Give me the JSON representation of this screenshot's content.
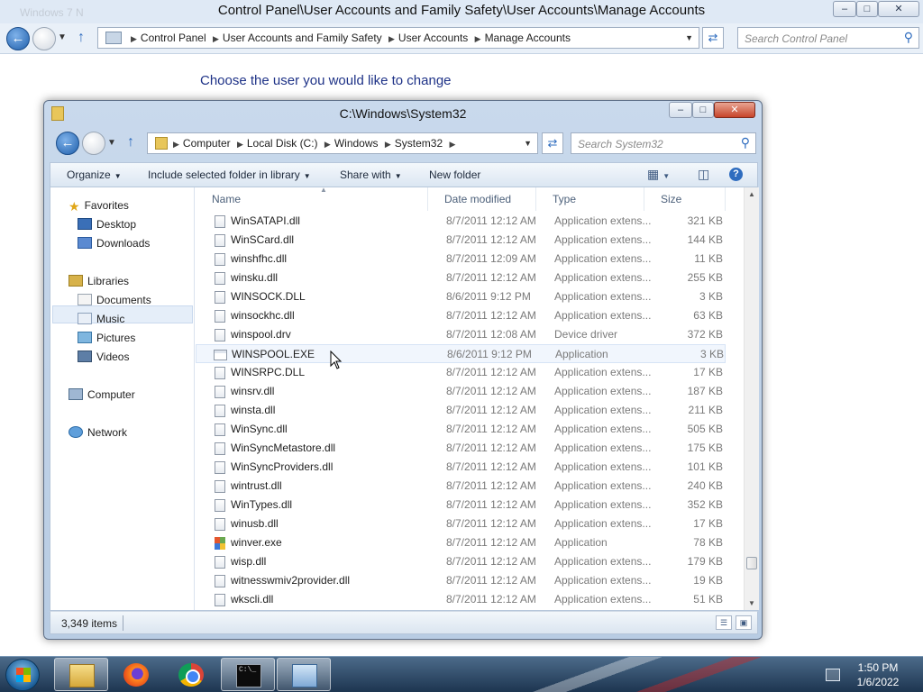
{
  "control_panel": {
    "ghost_title": "Windows 7 N",
    "title": "Control Panel\\User Accounts and Family Safety\\User Accounts\\Manage Accounts",
    "breadcrumbs": [
      "Control Panel",
      "User Accounts and Family Safety",
      "User Accounts",
      "Manage Accounts"
    ],
    "search_placeholder": "Search Control Panel",
    "heading": "Choose the user you would like to change"
  },
  "explorer": {
    "title": "C:\\Windows\\System32",
    "breadcrumbs": [
      "Computer",
      "Local Disk (C:)",
      "Windows",
      "System32"
    ],
    "search_placeholder": "Search System32",
    "toolbar": {
      "organize": "Organize",
      "include": "Include selected folder in library",
      "share": "Share with",
      "new_folder": "New folder"
    },
    "nav": {
      "favorites": "Favorites",
      "desktop": "Desktop",
      "downloads": "Downloads",
      "libraries": "Libraries",
      "documents": "Documents",
      "music": "Music",
      "pictures": "Pictures",
      "videos": "Videos",
      "computer": "Computer",
      "network": "Network"
    },
    "columns": {
      "name": "Name",
      "date": "Date modified",
      "type": "Type",
      "size": "Size"
    },
    "files": [
      {
        "name": "WinSATAPI.dll",
        "date": "8/7/2011 12:12 AM",
        "type": "Application extens...",
        "size": "321 KB",
        "icon": "dll"
      },
      {
        "name": "WinSCard.dll",
        "date": "8/7/2011 12:12 AM",
        "type": "Application extens...",
        "size": "144 KB",
        "icon": "dll"
      },
      {
        "name": "winshfhc.dll",
        "date": "8/7/2011 12:09 AM",
        "type": "Application extens...",
        "size": "11 KB",
        "icon": "dll"
      },
      {
        "name": "winsku.dll",
        "date": "8/7/2011 12:12 AM",
        "type": "Application extens...",
        "size": "255 KB",
        "icon": "dll"
      },
      {
        "name": "WINSOCK.DLL",
        "date": "8/6/2011 9:12 PM",
        "type": "Application extens...",
        "size": "3 KB",
        "icon": "dll"
      },
      {
        "name": "winsockhc.dll",
        "date": "8/7/2011 12:12 AM",
        "type": "Application extens...",
        "size": "63 KB",
        "icon": "dll"
      },
      {
        "name": "winspool.drv",
        "date": "8/7/2011 12:08 AM",
        "type": "Device driver",
        "size": "372 KB",
        "icon": "dll"
      },
      {
        "name": "WINSPOOL.EXE",
        "date": "8/6/2011 9:12 PM",
        "type": "Application",
        "size": "3 KB",
        "icon": "exe"
      },
      {
        "name": "WINSRPC.DLL",
        "date": "8/7/2011 12:12 AM",
        "type": "Application extens...",
        "size": "17 KB",
        "icon": "dll"
      },
      {
        "name": "winsrv.dll",
        "date": "8/7/2011 12:12 AM",
        "type": "Application extens...",
        "size": "187 KB",
        "icon": "dll"
      },
      {
        "name": "winsta.dll",
        "date": "8/7/2011 12:12 AM",
        "type": "Application extens...",
        "size": "211 KB",
        "icon": "dll"
      },
      {
        "name": "WinSync.dll",
        "date": "8/7/2011 12:12 AM",
        "type": "Application extens...",
        "size": "505 KB",
        "icon": "dll"
      },
      {
        "name": "WinSyncMetastore.dll",
        "date": "8/7/2011 12:12 AM",
        "type": "Application extens...",
        "size": "175 KB",
        "icon": "dll"
      },
      {
        "name": "WinSyncProviders.dll",
        "date": "8/7/2011 12:12 AM",
        "type": "Application extens...",
        "size": "101 KB",
        "icon": "dll"
      },
      {
        "name": "wintrust.dll",
        "date": "8/7/2011 12:12 AM",
        "type": "Application extens...",
        "size": "240 KB",
        "icon": "dll"
      },
      {
        "name": "WinTypes.dll",
        "date": "8/7/2011 12:12 AM",
        "type": "Application extens...",
        "size": "352 KB",
        "icon": "dll"
      },
      {
        "name": "winusb.dll",
        "date": "8/7/2011 12:12 AM",
        "type": "Application extens...",
        "size": "17 KB",
        "icon": "dll"
      },
      {
        "name": "winver.exe",
        "date": "8/7/2011 12:12 AM",
        "type": "Application",
        "size": "78 KB",
        "icon": "winver"
      },
      {
        "name": "wisp.dll",
        "date": "8/7/2011 12:12 AM",
        "type": "Application extens...",
        "size": "179 KB",
        "icon": "dll"
      },
      {
        "name": "witnesswmiv2provider.dll",
        "date": "8/7/2011 12:12 AM",
        "type": "Application extens...",
        "size": "19 KB",
        "icon": "dll"
      },
      {
        "name": "wkscli.dll",
        "date": "8/7/2011 12:12 AM",
        "type": "Application extens...",
        "size": "51 KB",
        "icon": "dll"
      }
    ],
    "hovered_row": 7,
    "status_count": "3,349 items"
  },
  "taskbar": {
    "apps": [
      "Windows Explorer",
      "Firefox",
      "Google Chrome",
      "Command Prompt",
      "Control Panel"
    ],
    "cmd_glyph": "C:\\_",
    "time": "1:50 PM",
    "date": "1/6/2022"
  }
}
